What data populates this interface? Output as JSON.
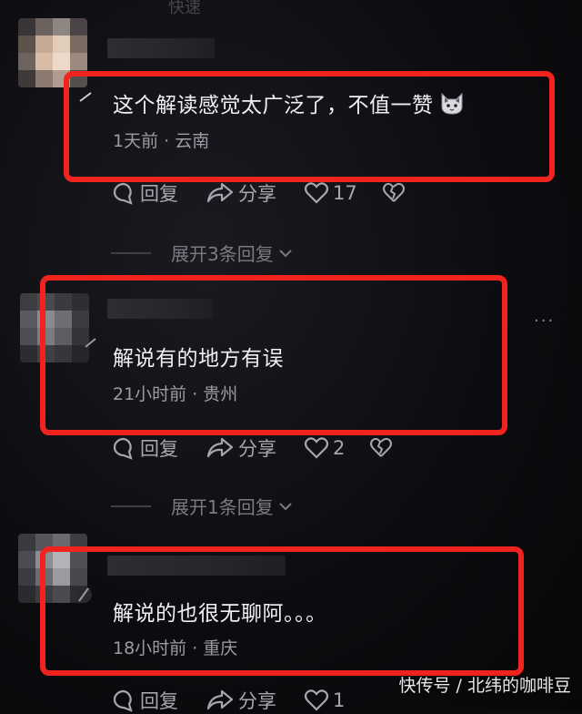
{
  "top_fragment": "快速",
  "comments": [
    {
      "text": "这个解读感觉太广泛了，不值一赞",
      "emoji": "cat-emoji",
      "meta": "1天前 · 云南",
      "actions": {
        "reply": "回复",
        "share": "分享",
        "likes": "17"
      },
      "expand": "展开3条回复"
    },
    {
      "text": "解说有的地方有误",
      "meta": "21小时前 · 贵州",
      "actions": {
        "reply": "回复",
        "share": "分享",
        "likes": "2"
      },
      "expand": "展开1条回复"
    },
    {
      "text": "解说的也很无聊阿。。。",
      "meta": "18小时前 · 重庆",
      "actions": {
        "reply": "回复",
        "share": "分享",
        "likes": "1"
      }
    }
  ],
  "more_menu": "···",
  "watermark": "快传号 / 北纬的咖啡豆",
  "colors": {
    "highlight_box": "#f0231e",
    "background": "#0a0a0c",
    "text": "#f0f0f2",
    "meta": "#9b9ba3"
  }
}
